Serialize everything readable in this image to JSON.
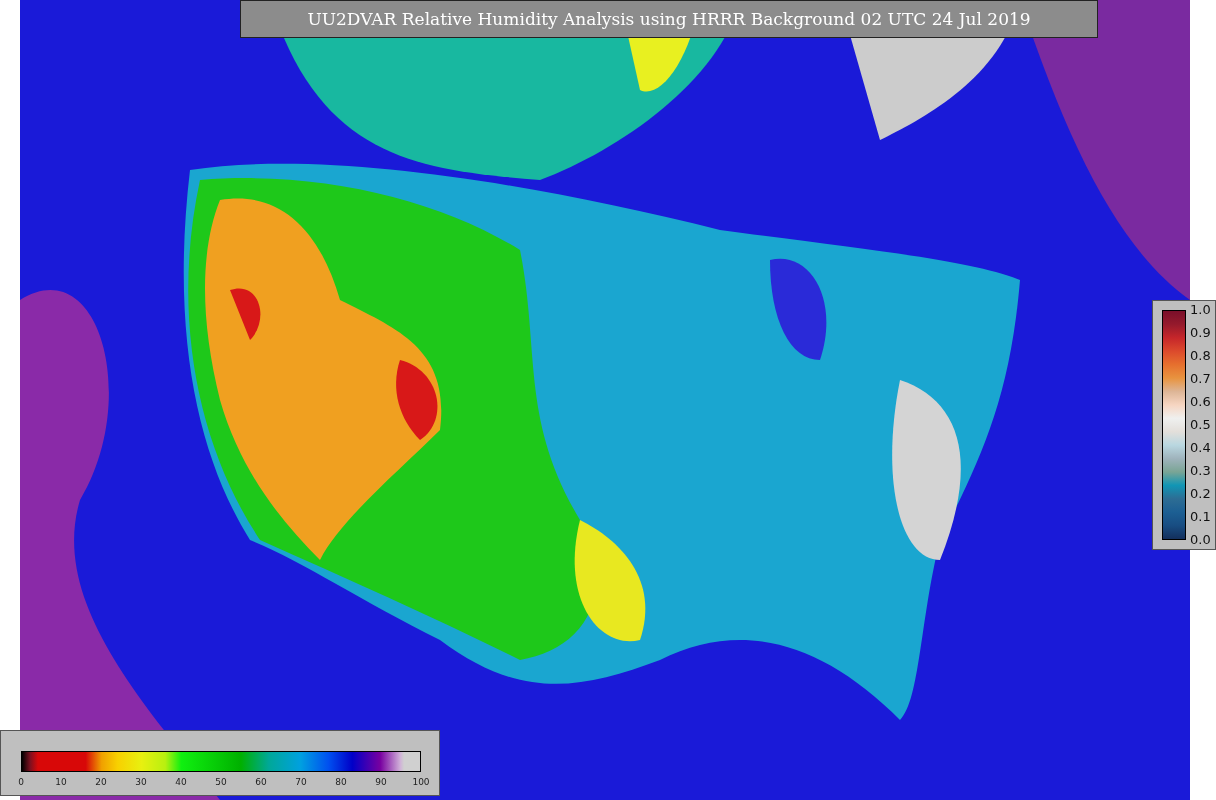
{
  "title": "UU2DVAR Relative Humidity Analysis using HRRR Background 02 UTC 24 Jul 2019",
  "side_colorbar": {
    "ticks": [
      "1.0",
      "0.9",
      "0.8",
      "0.7",
      "0.6",
      "0.5",
      "0.4",
      "0.3",
      "0.2",
      "0.1",
      "0.0"
    ]
  },
  "bottom_colorbar": {
    "ticks": [
      "0",
      "10",
      "20",
      "30",
      "40",
      "50",
      "60",
      "70",
      "80",
      "90",
      "100"
    ]
  }
}
